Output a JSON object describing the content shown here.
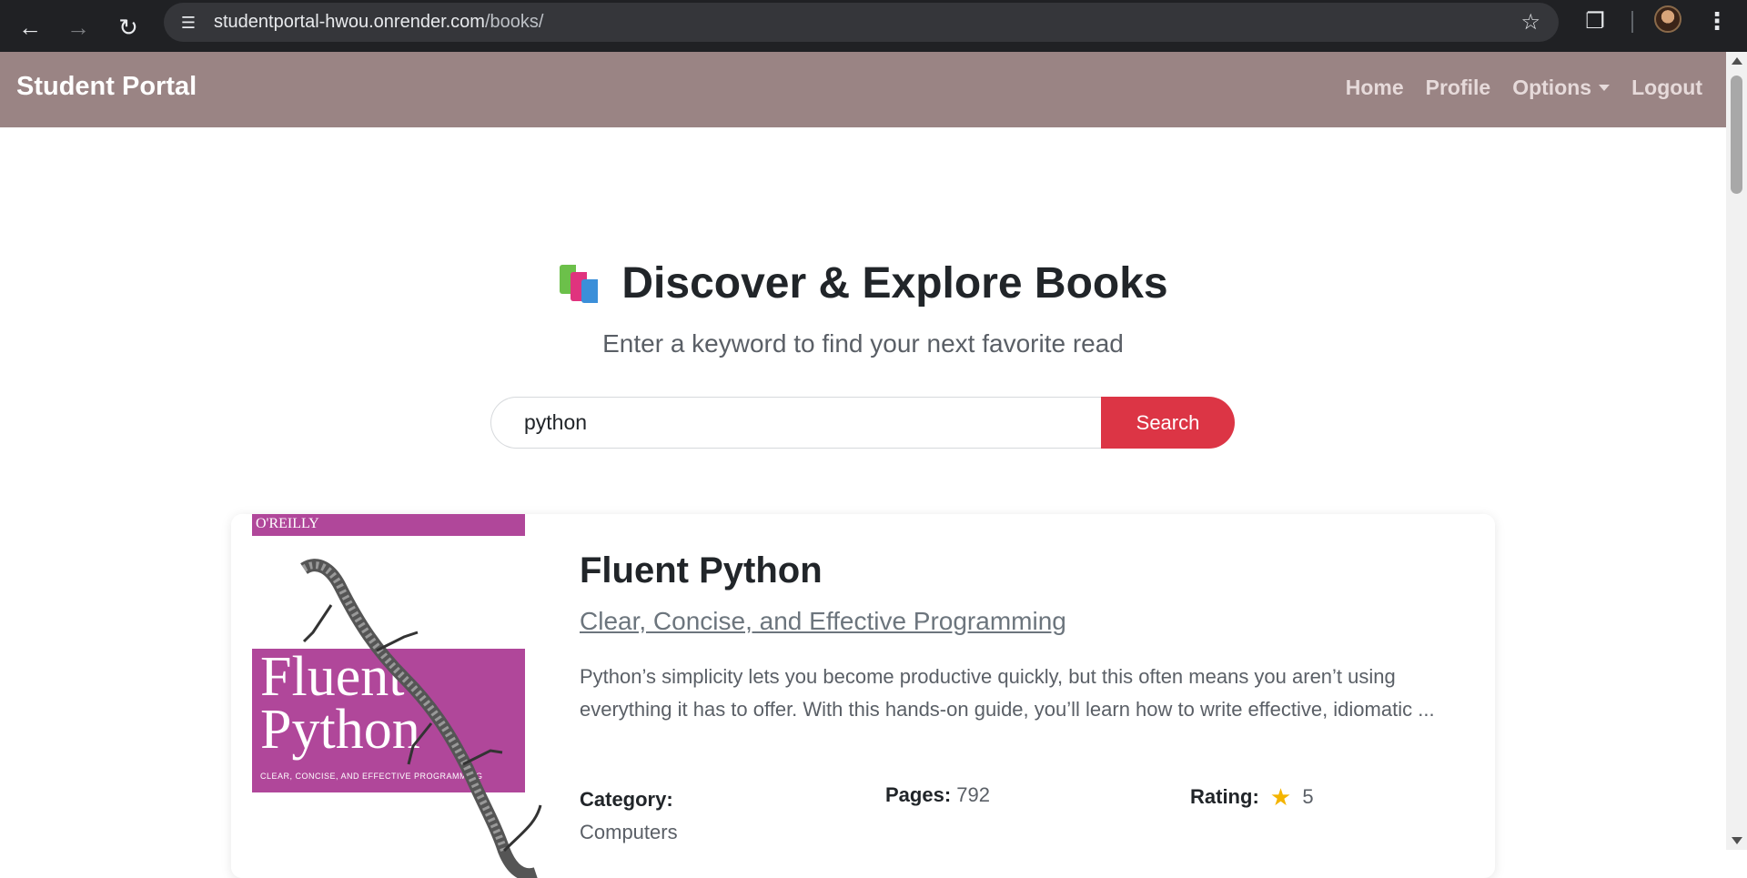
{
  "browser": {
    "url_host": "studentportal-hwou.onrender.com",
    "url_path": "/books/",
    "back_icon": "arrow-left-icon",
    "forward_icon": "arrow-right-icon",
    "reload_icon": "reload-icon",
    "star_icon": "star-icon",
    "extension_icon": "puzzle-icon",
    "menu_icon": "kebab-menu-icon"
  },
  "navbar": {
    "brand": "Student Portal",
    "links": {
      "home": "Home",
      "profile": "Profile",
      "options": "Options",
      "logout": "Logout"
    },
    "color": "#9a8484"
  },
  "hero": {
    "title": "Discover & Explore Books",
    "subtitle": "Enter a keyword to find your next favorite read"
  },
  "search": {
    "value": "python",
    "button_label": "Search",
    "button_color": "#dc3545"
  },
  "results": [
    {
      "cover": {
        "publisher": "O'REILLY",
        "title_line1": "Fluent",
        "title_line2": "Python",
        "subtitle": "CLEAR, CONCISE, AND EFFECTIVE PROGRAMMING"
      },
      "title": "Fluent Python",
      "subtitle": "Clear, Concise, and Effective Programming",
      "description": "Python’s simplicity lets you become productive quickly, but this often means you aren’t using everything it has to offer. With this hands-on guide, you’ll learn how to write effective, idiomatic ...",
      "category_label": "Category:",
      "category": "Computers",
      "pages_label": "Pages:",
      "pages": "792",
      "rating_label": "Rating:",
      "rating": "5"
    }
  ]
}
